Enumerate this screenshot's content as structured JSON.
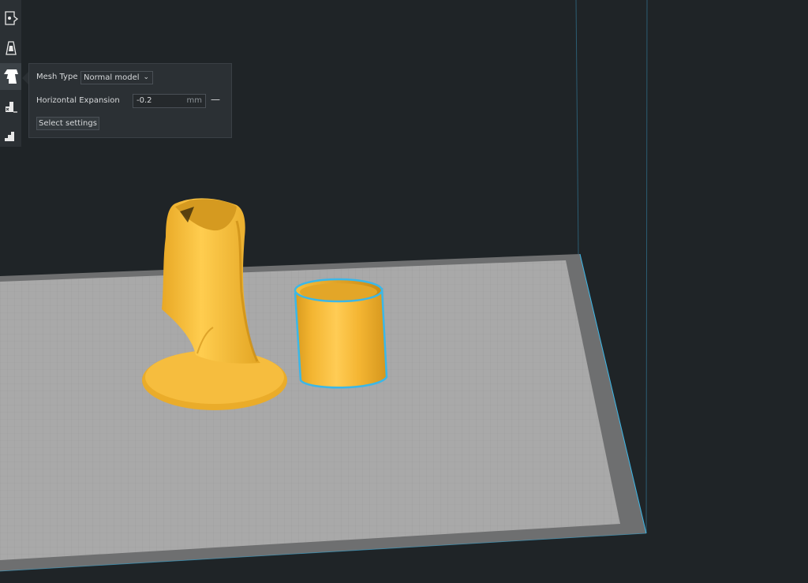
{
  "toolbar": {
    "tools": [
      {
        "name": "per-model-normal-icon"
      },
      {
        "name": "per-model-support-icon"
      },
      {
        "name": "per-model-settings-icon"
      },
      {
        "name": "per-model-overlap-icon"
      },
      {
        "name": "per-model-anti-overhang-icon"
      }
    ],
    "active_index": 2
  },
  "settings_panel": {
    "mesh_type_label": "Mesh Type",
    "mesh_type_value": "Normal model",
    "horizontal_expansion_label": "Horizontal Expansion",
    "horizontal_expansion_value": "-0.2",
    "horizontal_expansion_unit": "mm",
    "select_settings_label": "Select settings"
  },
  "colors": {
    "background": "#1f2427",
    "build_plate": "#a8a8a8",
    "model": "#f5b933",
    "selection_outline": "#3bb7e8"
  }
}
